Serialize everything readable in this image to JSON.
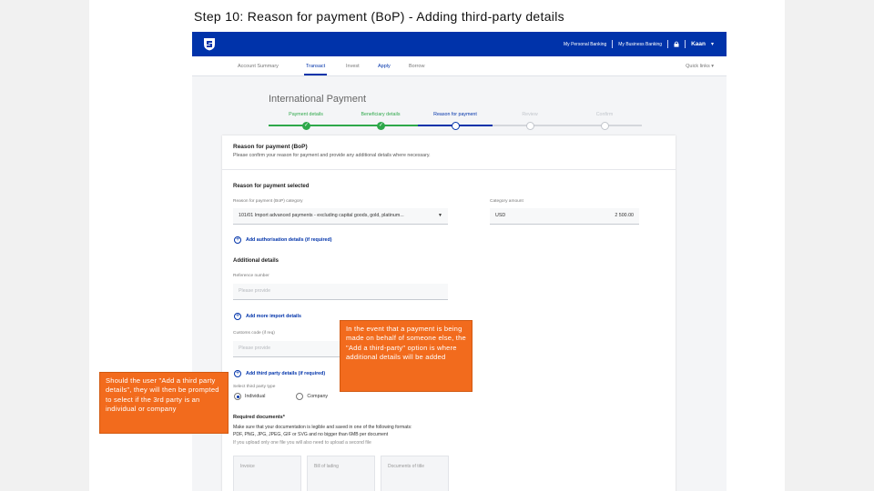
{
  "slide_title": "Step 10: Reason for payment (BoP) - Adding third-party details",
  "topbar": {
    "logo_icon": "standard-bank-shield-icon",
    "link_personal": "My Personal Banking",
    "link_business": "My Business Banking",
    "user_name": "Kaan"
  },
  "subnav": {
    "tabs": [
      "Account Summary",
      "Transact",
      "Invest",
      "Apply",
      "Borrow"
    ],
    "active_tab": "Transact",
    "quick_links": "Quick links"
  },
  "page_heading": "International Payment",
  "stepper": {
    "steps": [
      {
        "label": "Payment details",
        "state": "done"
      },
      {
        "label": "Beneficiary details",
        "state": "done"
      },
      {
        "label": "Reason for payment",
        "state": "current"
      },
      {
        "label": "Review",
        "state": "pending"
      },
      {
        "label": "Confirm",
        "state": "pending"
      }
    ]
  },
  "card": {
    "title": "Reason for payment (BoP)",
    "subtitle": "Please confirm your reason for payment and provide any additional details where necessary.",
    "section_selected": "Reason for payment selected",
    "bop_category_label": "Reason for payment (BoP) category",
    "bop_category_value": "101/01 Import advanced payments - excluding capital goods, gold, platinum...",
    "category_amount_label": "Category amount",
    "currency": "USD",
    "amount": "2 500.00",
    "add_authorisation": "Add authorisation details (if required)",
    "section_additional": "Additional details",
    "ref_label": "Reference number",
    "ref_placeholder": "Please provide",
    "add_import": "Add more import details",
    "customs_label": "Customs code (if req)",
    "customs_placeholder": "Please provide",
    "add_third_party": "Add third party details (if required)",
    "third_party_type_label": "Select third party type",
    "radio_individual": "Individual",
    "radio_company": "Company",
    "required_docs": "Required documents*",
    "docs_line1": "Make sure that your documentation is legible and saved in one of the following formats:",
    "docs_line2": "PDF, PNG, JPG, JPEG, GIF or SVG and no bigger than 6MB per document",
    "docs_line3": "If you upload only one file you will also need to upload a second file",
    "upload_boxes": [
      "Invoice",
      "Bill of lading",
      "Documents of title"
    ]
  },
  "callouts": {
    "left": "Should the user \"Add a third party details\", they will then be prompted to select if the 3rd party is an individual or company",
    "right": "In the event that a payment is being made on behalf of someone else, the \"Add a third-party\" option is where additional details will be added"
  },
  "colors": {
    "brand_blue": "#0033aa",
    "step_done_green": "#2ea84a",
    "callout_orange": "#f26b1d"
  }
}
